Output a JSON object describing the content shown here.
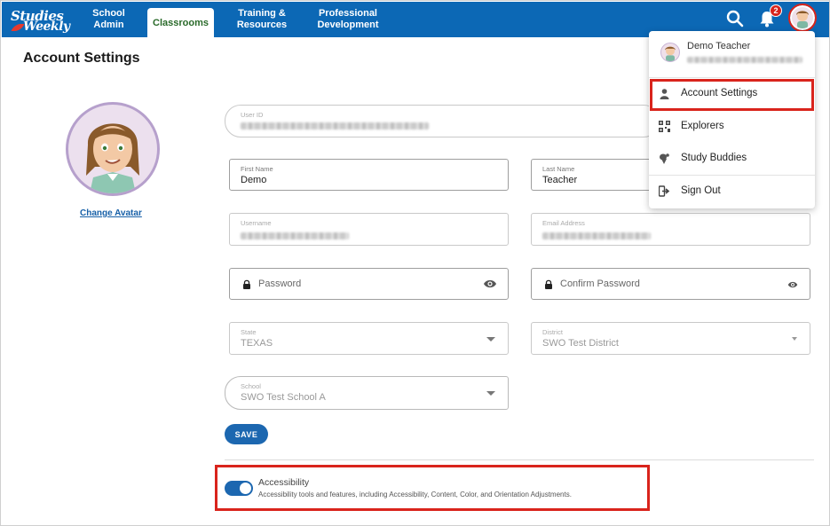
{
  "nav": {
    "logo_line1": "Studies",
    "logo_line2": "Weekly",
    "items": [
      {
        "label": "School\nAdmin"
      },
      {
        "label": "Classrooms"
      },
      {
        "label": "Training &\nResources"
      },
      {
        "label": "Professional\nDevelopment"
      }
    ],
    "notification_count": "2",
    "icons": {
      "search": "search-icon",
      "bell": "bell-icon"
    }
  },
  "page": {
    "title": "Account Settings",
    "change_avatar": "Change Avatar"
  },
  "form": {
    "user_id": {
      "label": "User ID"
    },
    "first_name": {
      "label": "First Name",
      "value": "Demo"
    },
    "last_name": {
      "label": "Last Name",
      "value": "Teacher"
    },
    "username": {
      "label": "Username"
    },
    "email": {
      "label": "Email Address"
    },
    "password": {
      "placeholder": "Password"
    },
    "confirm_password": {
      "placeholder": "Confirm Password"
    },
    "state": {
      "label": "State",
      "value": "TEXAS"
    },
    "district": {
      "label": "District",
      "value": "SWO Test District"
    },
    "school": {
      "label": "School",
      "value": "SWO Test School A"
    },
    "save_label": "SAVE"
  },
  "accessibility": {
    "title": "Accessibility",
    "description": "Accessibility tools and features, including Accessibility, Content, Color, and Orientation Adjustments.",
    "enabled": true
  },
  "menu": {
    "name": "Demo Teacher",
    "items": [
      {
        "label": "Account Settings",
        "icon": "person-icon"
      },
      {
        "label": "Explorers",
        "icon": "explorers-icon"
      },
      {
        "label": "Study Buddies",
        "icon": "study-buddies-icon"
      },
      {
        "label": "Sign Out",
        "icon": "sign-out-icon"
      }
    ]
  },
  "colors": {
    "nav": "#0c68b5",
    "accent": "#1c67b0",
    "highlight": "#d9241c"
  }
}
